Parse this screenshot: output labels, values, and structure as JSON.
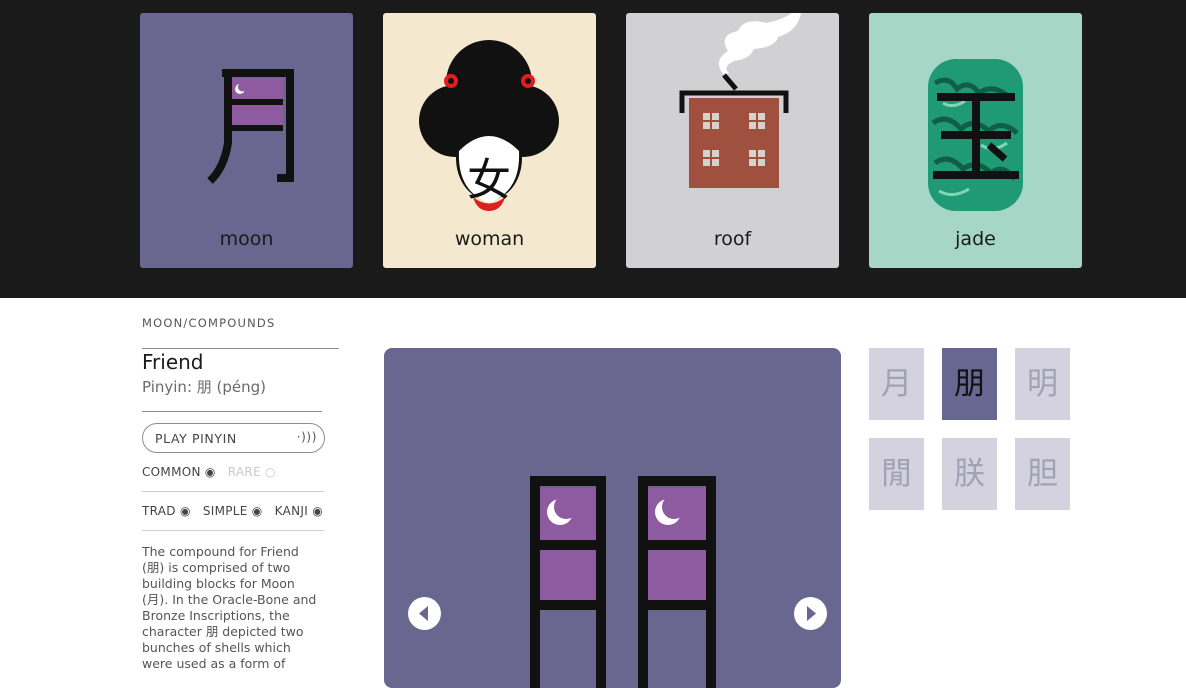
{
  "cards": [
    {
      "label": "moon",
      "bg": "#696690"
    },
    {
      "label": "woman",
      "bg": "#f4e9ce"
    },
    {
      "label": "roof",
      "bg": "#d1d1d3"
    },
    {
      "label": "jade",
      "bg": "#a6d7c6"
    }
  ],
  "breadcrumb": "MOON/COMPOUNDS",
  "entry": {
    "title": "Friend",
    "pinyin": "Pinyin: 朋 (péng)"
  },
  "play": {
    "label": "PLAY PINYIN",
    "icon": "·)))"
  },
  "frequency": {
    "common": "COMMON ◉",
    "rare": "RARE ○"
  },
  "scripts": {
    "trad": "TRAD ◉",
    "simple": "SIMPLE ◉",
    "kanji": "KANJI ◉"
  },
  "description": "The compound for Friend (朋) is comprised of two building blocks for Moon (月). In the Oracle-Bone and Bronze Inscriptions, the character 朋 depicted two bunches of shells which were used as a form of",
  "compounds": [
    "月",
    "朋",
    "明",
    "閒",
    "朕",
    "胆"
  ],
  "colors": {
    "accent": "#696690",
    "moon_window": "#8e5aa0",
    "roof_house": "#a0503e",
    "jade": "#1f9a74"
  }
}
